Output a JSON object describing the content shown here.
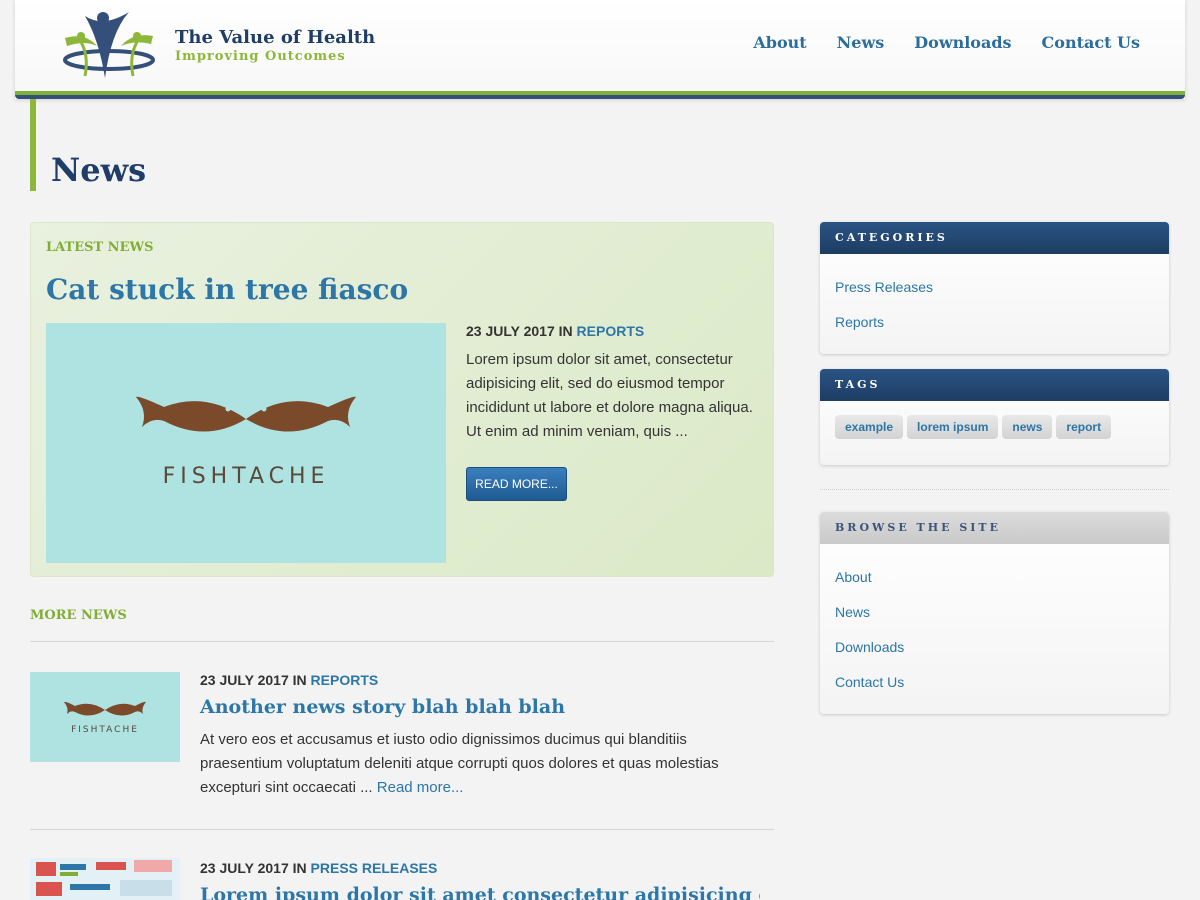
{
  "header": {
    "logo_title": "The Value of Health",
    "logo_subtitle": "Improving Outcomes",
    "nav": [
      "About",
      "News",
      "Downloads",
      "Contact Us"
    ]
  },
  "page": {
    "title": "News"
  },
  "latest": {
    "label": "LATEST NEWS",
    "title": "Cat stuck in tree fiasco",
    "image_text": "FISHTACHE",
    "date": "23 JULY 2017 IN",
    "category": "REPORTS",
    "excerpt": "Lorem ipsum dolor sit amet, consectetur adipisicing elit, sed do eiusmod tempor incididunt ut labore et dolore magna aliqua. Ut enim ad minim veniam, quis ...",
    "button": "READ MORE..."
  },
  "more": {
    "label": "MORE NEWS",
    "items": [
      {
        "date": "23 JULY 2017 IN",
        "category": "REPORTS",
        "title": "Another news story blah blah blah",
        "thumb_text": "FISHTACHE",
        "excerpt": "At vero eos et accusamus et iusto odio dignissimos ducimus qui blanditiis praesentium voluptatum deleniti atque corrupti quos dolores et quas molestias excepturi sint occaecati ...",
        "read_more": "Read more..."
      },
      {
        "date": "23 JULY 2017 IN",
        "category": "PRESS RELEASES",
        "title": "Lorem ipsum dolor sit amet consectetur adipisicing elit sed do"
      }
    ]
  },
  "sidebar": {
    "categories": {
      "title": "CATEGORIES",
      "items": [
        "Press Releases",
        "Reports"
      ]
    },
    "tags": {
      "title": "TAGS",
      "items": [
        "example",
        "lorem ipsum",
        "news",
        "report"
      ]
    },
    "browse": {
      "title": "BROWSE THE SITE",
      "items": [
        "About",
        "News",
        "Downloads",
        "Contact Us"
      ]
    }
  },
  "colors": {
    "brand_navy": "#1f3d66",
    "brand_green": "#8cb73a",
    "link_blue": "#2c76a8",
    "thumb_bg": "#aee3e2",
    "mustache_brown": "#7a4a2b"
  }
}
